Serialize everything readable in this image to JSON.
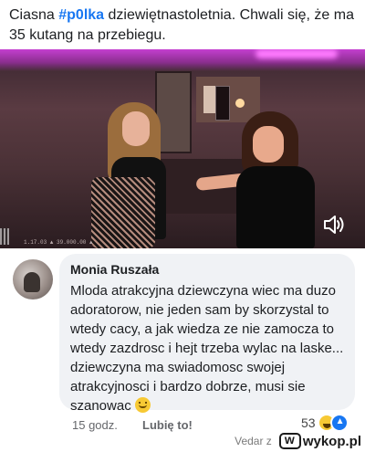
{
  "post": {
    "prefix": "Ciasna ",
    "hashtag": "#p0lka",
    "suffix": " dziewiętnastoletnia. Chwali się, że ma 35 kutang na przebiegu."
  },
  "video": {
    "stream_overlay": "1.17.03 ▲ 39.000.00 ▲",
    "sound_icon": "volume-icon"
  },
  "comment": {
    "author": "Monia Ruszała",
    "text": "Mloda atrakcyjna dziewczyna wiec ma duzo adoratorow, nie jeden sam by skorzystal to wtedy cacy, a jak wiedza ze nie zamocza to wtedy zazdrosc i hejt trzeba wylac na laske... dziewczyna ma swiadomosc swojej atrakcyjnosci i bardzo dobrze, musi sie szanowac",
    "emoji": "slightly-smiling-face",
    "time": "15 godz.",
    "like_label": "Lubię to!",
    "reaction_count": "53",
    "reactions": [
      "laugh",
      "like"
    ]
  },
  "watermark": {
    "user": "Vedar z",
    "site": "wykop.pl"
  }
}
